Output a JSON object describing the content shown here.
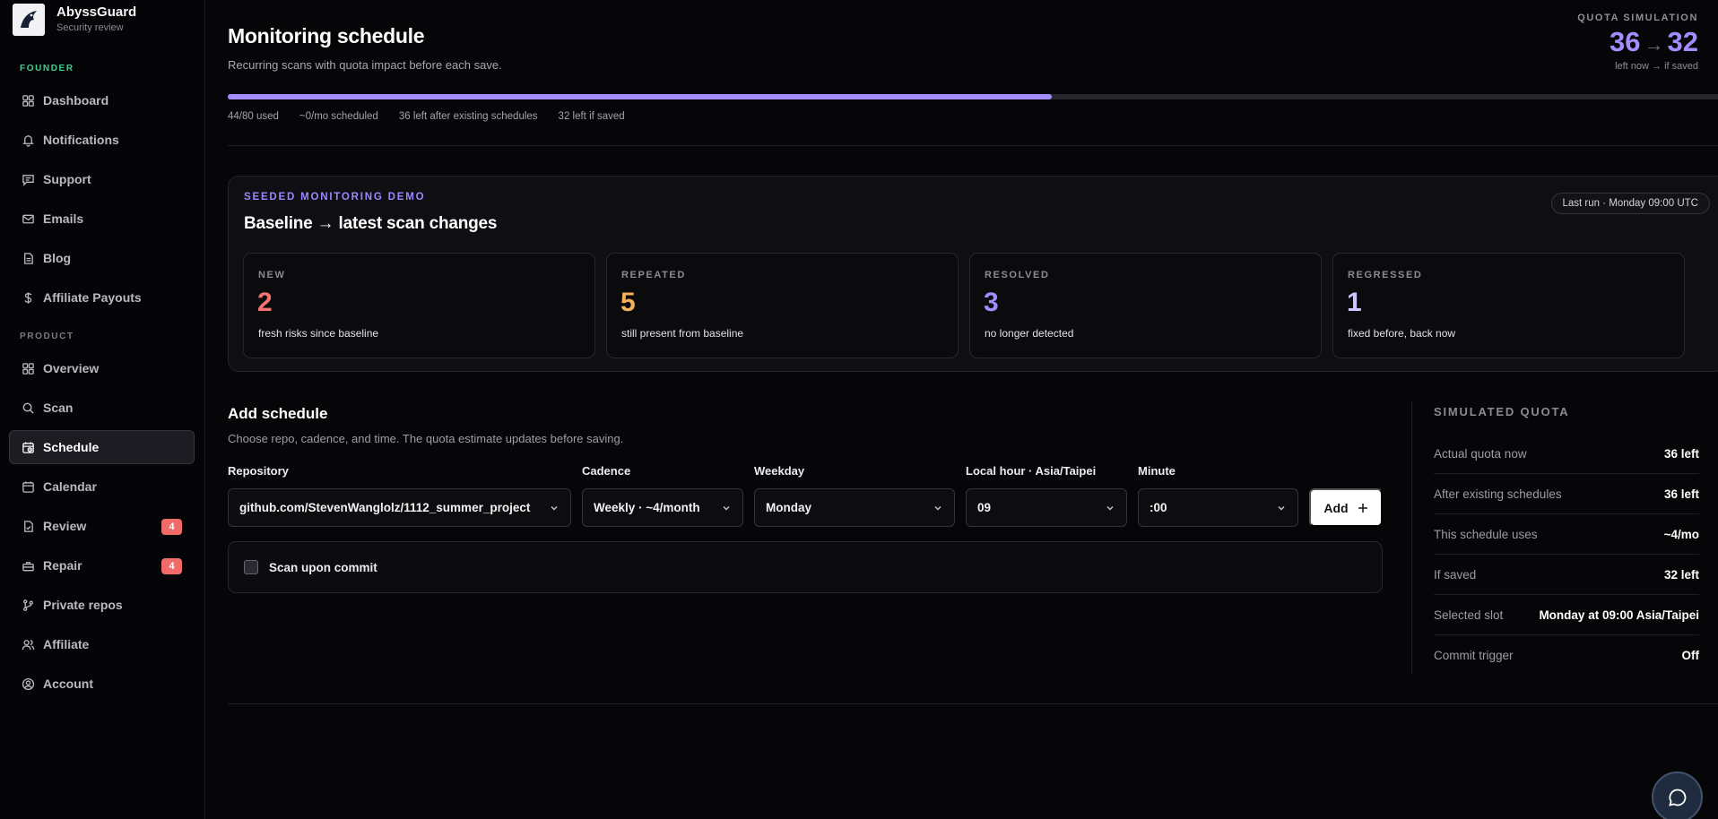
{
  "brand": {
    "name": "AbyssGuard",
    "subtitle": "Security review"
  },
  "sidebar": {
    "founder_label": "FOUNDER",
    "founder_items": [
      {
        "label": "Dashboard",
        "icon": "grid-icon"
      },
      {
        "label": "Notifications",
        "icon": "bell-icon"
      },
      {
        "label": "Support",
        "icon": "message-square-icon"
      },
      {
        "label": "Emails",
        "icon": "mail-icon"
      },
      {
        "label": "Blog",
        "icon": "file-icon"
      },
      {
        "label": "Affiliate Payouts",
        "icon": "dollar-icon"
      }
    ],
    "product_label": "PRODUCT",
    "product_items": [
      {
        "label": "Overview",
        "icon": "grid-icon"
      },
      {
        "label": "Scan",
        "icon": "search-icon"
      },
      {
        "label": "Schedule",
        "icon": "calendar-clock-icon",
        "active": true
      },
      {
        "label": "Calendar",
        "icon": "calendar-icon"
      },
      {
        "label": "Review",
        "icon": "file-check-icon",
        "badge": "4"
      },
      {
        "label": "Repair",
        "icon": "toolbox-icon",
        "badge": "4"
      },
      {
        "label": "Private repos",
        "icon": "git-branch-icon"
      },
      {
        "label": "Affiliate",
        "icon": "users-icon"
      },
      {
        "label": "Account",
        "icon": "user-circle-icon"
      }
    ]
  },
  "header": {
    "title": "Monitoring schedule",
    "subtitle": "Recurring scans with quota impact before each save."
  },
  "quota_simulation": {
    "label": "QUOTA SIMULATION",
    "now": "36",
    "arrow": "→",
    "if_saved": "32",
    "caption": "left now → if saved"
  },
  "usage": {
    "used_fraction": 0.55,
    "stats": [
      "44/80 used",
      "~0/mo scheduled",
      "36 left after existing schedules",
      "32 left if saved"
    ]
  },
  "demo": {
    "eyebrow": "SEEDED MONITORING DEMO",
    "title": "Baseline → latest scan changes",
    "last_run": "Last run · Monday 09:00 UTC",
    "cards": [
      {
        "label": "NEW",
        "value": "2",
        "desc": "fresh risks since baseline",
        "color": "#f47272"
      },
      {
        "label": "REPEATED",
        "value": "5",
        "desc": "still present from baseline",
        "color": "#f5b15a"
      },
      {
        "label": "RESOLVED",
        "value": "3",
        "desc": "no longer detected",
        "color": "#a48cff"
      },
      {
        "label": "REGRESSED",
        "value": "1",
        "desc": "fixed before, back now",
        "color": "#cfc4ff"
      }
    ]
  },
  "add_schedule": {
    "title": "Add schedule",
    "subtitle": "Choose repo, cadence, and time. The quota estimate updates before saving.",
    "repository": {
      "label": "Repository",
      "value": "github.com/StevenWanglolz/1112_summer_project"
    },
    "cadence": {
      "label": "Cadence",
      "value": "Weekly · ~4/month"
    },
    "weekday": {
      "label": "Weekday",
      "value": "Monday"
    },
    "hour": {
      "label": "Local hour · Asia/Taipei",
      "value": "09"
    },
    "minute": {
      "label": "Minute",
      "value": ":00"
    },
    "add_label": "Add",
    "add_icon": "plus-icon",
    "commit_label": "Scan upon commit",
    "commit_checked": false
  },
  "simulated_quota": {
    "title": "SIMULATED QUOTA",
    "rows": [
      {
        "key": "Actual quota now",
        "value": "36 left"
      },
      {
        "key": "After existing schedules",
        "value": "36 left"
      },
      {
        "key": "This schedule uses",
        "value": "~4/mo"
      },
      {
        "key": "If saved",
        "value": "32 left"
      },
      {
        "key": "Selected slot",
        "value": "Monday at 09:00 Asia/Taipei"
      },
      {
        "key": "Commit trigger",
        "value": "Off"
      }
    ]
  },
  "colors": {
    "accent": "#a58dff",
    "badge": "#f06a6a",
    "founder_label": "#3ecf8e",
    "product_label": "#7a7a82"
  }
}
